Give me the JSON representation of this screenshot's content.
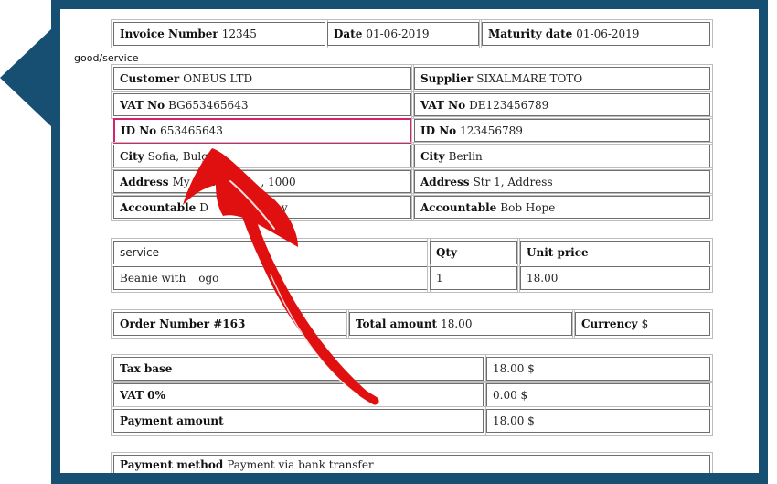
{
  "invoice": {
    "invoice_number_label": "Invoice Number",
    "invoice_number": "12345",
    "date_label": "Date",
    "date": "01-06-2019",
    "maturity_label": "Maturity date",
    "maturity": "01-06-2019"
  },
  "section_label": "good/service",
  "customer": {
    "name_label": "Customer",
    "name": "ONBUS LTD",
    "vat_label": "VAT No",
    "vat": "BG653465643",
    "id_label": "ID No",
    "id": "653465643",
    "city_label": "City",
    "city": "Sofia, Bulgar",
    "address_label": "Address",
    "address": "My Add",
    "address_tail": ", 1000",
    "accountable_label": "Accountable",
    "accountable": "D",
    "accountable_tail": "y"
  },
  "supplier": {
    "name_label": "Supplier",
    "name": "SIXALMARE TOTO",
    "vat_label": "VAT No",
    "vat": "DE123456789",
    "id_label": "ID No",
    "id": "123456789",
    "city_label": "City",
    "city": "Berlin",
    "address_label": "Address",
    "address": "Str 1, Address",
    "accountable_label": "Accountable",
    "accountable": "Bob Hope"
  },
  "items": {
    "col_service": "service",
    "col_qty": "Qty",
    "col_price": "Unit price",
    "row_name": "Beanie with",
    "row_name_tail": "ogo",
    "row_qty": "1",
    "row_price": "18.00"
  },
  "order": {
    "order_label": "Order Number #163",
    "total_label": "Total amount",
    "total": "18.00",
    "currency_label": "Currency",
    "currency": "$"
  },
  "summary": {
    "tax_base_label": "Tax base",
    "tax_base": "18.00 $",
    "vat_label": "VAT 0%",
    "vat": "0.00 $",
    "payment_label": "Payment amount",
    "payment": "18.00 $"
  },
  "payment_method": {
    "label": "Payment method",
    "value": "Payment via bank transfer"
  },
  "colors": {
    "frame": "#174f73",
    "highlight_border": "#d6236e",
    "arrow": "#e01010"
  }
}
